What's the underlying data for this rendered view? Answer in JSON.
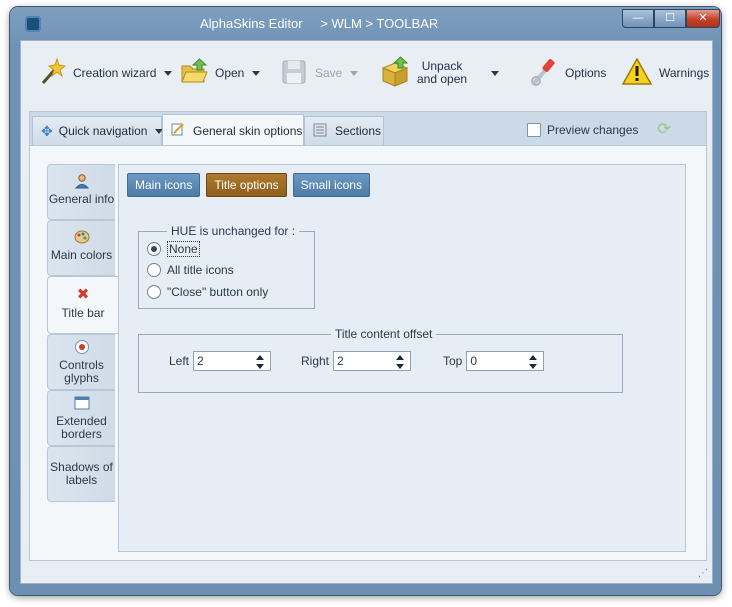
{
  "window": {
    "app_name": "AlphaSkins Editor",
    "path": "> WLM > TOOLBAR",
    "minimize_glyph": "—",
    "maximize_glyph": "☐",
    "close_glyph": "✕"
  },
  "toolbar": {
    "creation_wizard": "Creation wizard",
    "open": "Open",
    "save": "Save",
    "unpack_line1": "Unpack",
    "unpack_line2": "and open",
    "options": "Options",
    "warnings": "Warnings"
  },
  "tabs": {
    "quick_navigation": "Quick navigation",
    "general_skin_options": "General  skin options",
    "sections": "Sections",
    "preview_changes": "Preview changes",
    "preview_checked": false
  },
  "side_tabs": [
    {
      "line1": "General info",
      "line2": "",
      "icon": "user-icon"
    },
    {
      "line1": "Main colors",
      "line2": "",
      "icon": "palette-icon"
    },
    {
      "line1": "Title bar",
      "line2": "",
      "icon": "red-x-icon"
    },
    {
      "line1": "Controls",
      "line2": "glyphs",
      "icon": "radio-glyph-icon"
    },
    {
      "line1": "Extended",
      "line2": "borders",
      "icon": "window-icon"
    },
    {
      "line1": "Shadows of",
      "line2": "labels",
      "icon": ""
    }
  ],
  "active_side_tab": "Title bar",
  "sub_tabs": [
    "Main icons",
    "Title options",
    "Small icons"
  ],
  "active_sub_tab": "Title options",
  "hue_group": {
    "title": "HUE is unchanged for :",
    "options": [
      "None",
      "All title icons",
      "\"Close\" button only"
    ],
    "selected": "None"
  },
  "offset_group": {
    "title": "Title content offset",
    "left_label": "Left",
    "left_value": "2",
    "right_label": "Right",
    "right_value": "2",
    "top_label": "Top",
    "top_value": "0"
  },
  "colors": {
    "title_bar": "#6f92b6",
    "selected_subtab": "#a06d24",
    "subtab": "#5a88b3",
    "close_button": "#c4412a"
  }
}
